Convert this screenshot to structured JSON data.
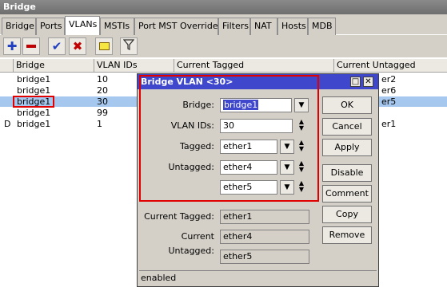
{
  "window": {
    "title": "Bridge"
  },
  "tabs": [
    "Bridge",
    "Ports",
    "VLANs",
    "MSTIs",
    "Port MST Overrides",
    "Filters",
    "NAT",
    "Hosts",
    "MDB"
  ],
  "toolbar": {
    "add_icon": "plus-icon",
    "remove_icon": "minus-icon",
    "enable_icon": "check-icon",
    "disable_icon": "x-icon",
    "comment_icon": "note-icon",
    "filter_icon": "filter-icon"
  },
  "table": {
    "columns": [
      "Bridge",
      "VLAN IDs",
      "Current Tagged",
      "Current Untagged"
    ],
    "rows": [
      {
        "flag": "",
        "bridge": "bridge1",
        "vlan": "10",
        "tagged": "",
        "untagged": "er2"
      },
      {
        "flag": "",
        "bridge": "bridge1",
        "vlan": "20",
        "tagged": "",
        "untagged": "er6"
      },
      {
        "flag": "",
        "bridge": "bridge1",
        "vlan": "30",
        "tagged": "",
        "untagged": "er5"
      },
      {
        "flag": "",
        "bridge": "bridge1",
        "vlan": "99",
        "tagged": "",
        "untagged": ""
      },
      {
        "flag": "D",
        "bridge": "bridge1",
        "vlan": "1",
        "tagged": "",
        "untagged": "er1"
      }
    ]
  },
  "dialog": {
    "title": "Bridge VLAN <30>",
    "labels": {
      "bridge": "Bridge:",
      "vlan_ids": "VLAN IDs:",
      "tagged": "Tagged:",
      "untagged": "Untagged:",
      "current_tagged": "Current Tagged:",
      "current_untagged": "Current Untagged:"
    },
    "values": {
      "bridge": "bridge1",
      "vlan_ids": "30",
      "tagged": "ether1",
      "untagged_1": "ether4",
      "untagged_2": "ether5",
      "current_tagged": "ether1",
      "current_untagged_1": "ether4",
      "current_untagged_2": "ether5"
    },
    "buttons": {
      "ok": "OK",
      "cancel": "Cancel",
      "apply": "Apply",
      "disable": "Disable",
      "comment": "Comment",
      "copy": "Copy",
      "remove": "Remove"
    },
    "status": "enabled"
  },
  "colors": {
    "dialog_title": "#3f48cc",
    "highlight": "#e00000",
    "selected_row": "#a6c7ee"
  }
}
